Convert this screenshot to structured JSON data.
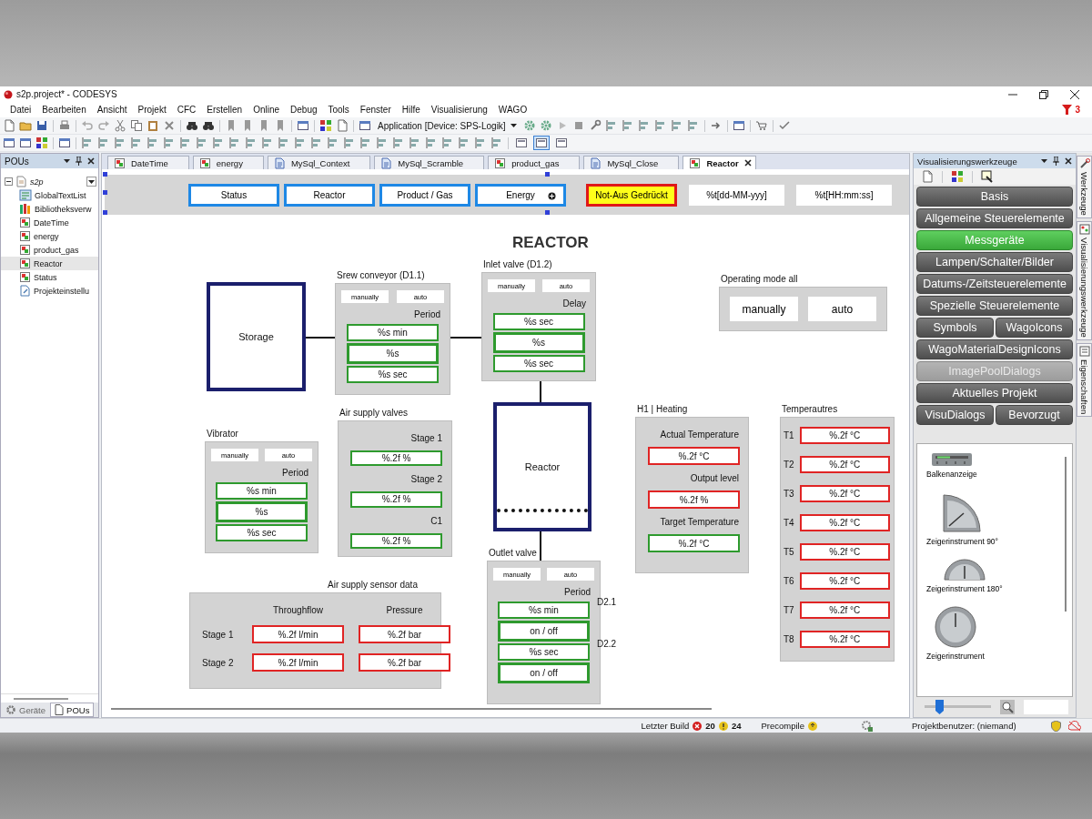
{
  "window": {
    "title": "s2p.project* - CODESYS",
    "alert_count": "3"
  },
  "menu": [
    "Datei",
    "Bearbeiten",
    "Ansicht",
    "Projekt",
    "CFC",
    "Erstellen",
    "Online",
    "Debug",
    "Tools",
    "Fenster",
    "Hilfe",
    "Visualisierung",
    "WAGO"
  ],
  "toolbar": {
    "application": "Application [Device: SPS-Logik]",
    "layout_toggles": [
      {
        "selected": false
      },
      {
        "selected": true
      },
      {
        "selected": false
      }
    ]
  },
  "pou_panel": {
    "title": "POUs",
    "tree": [
      {
        "label": "s2p",
        "kind": "project",
        "selected": false,
        "expanded": true,
        "children": [
          {
            "label": "GlobalTextList",
            "kind": "textlist",
            "selected": false
          },
          {
            "label": "Bibliotheksverw",
            "kind": "library",
            "selected": false
          },
          {
            "label": "DateTime",
            "kind": "visu",
            "selected": false
          },
          {
            "label": "energy",
            "kind": "visu",
            "selected": false
          },
          {
            "label": "product_gas",
            "kind": "visu",
            "selected": false
          },
          {
            "label": "Reactor",
            "kind": "visu",
            "selected": true
          },
          {
            "label": "Status",
            "kind": "visu",
            "selected": false
          },
          {
            "label": "Projekteinstellu",
            "kind": "settings",
            "selected": false
          }
        ]
      }
    ],
    "tabs": [
      {
        "label": "Geräte",
        "selected": false
      },
      {
        "label": "POUs",
        "selected": true
      }
    ]
  },
  "editor": {
    "tabs": [
      {
        "label": "DateTime",
        "kind": "visu",
        "selected": false
      },
      {
        "label": "energy",
        "kind": "visu",
        "selected": false
      },
      {
        "label": "MySql_Context",
        "kind": "program",
        "selected": false
      },
      {
        "label": "MySql_Scramble",
        "kind": "program",
        "selected": false
      },
      {
        "label": "product_gas",
        "kind": "visu",
        "selected": false
      },
      {
        "label": "MySql_Close",
        "kind": "program",
        "selected": false
      },
      {
        "label": "Reactor",
        "kind": "visu",
        "selected": true
      }
    ],
    "header": {
      "selected": true,
      "buttons": [
        {
          "label": "Status",
          "kind": "nav",
          "hovered": false
        },
        {
          "label": "Reactor",
          "kind": "nav",
          "hovered": false
        },
        {
          "label": "Product / Gas",
          "kind": "nav",
          "hovered": false
        },
        {
          "label": "Energy",
          "kind": "nav",
          "hovered": true
        },
        {
          "label": "Not-Aus Gedrückt",
          "kind": "alarm",
          "hovered": false
        },
        {
          "label": "%t[dd-MM-yyy]",
          "kind": "display",
          "hovered": false
        },
        {
          "label": "%t[HH:mm:ss]",
          "kind": "display",
          "hovered": false
        }
      ]
    },
    "canvas": {
      "title": "REACTOR",
      "items": [
        {
          "kind": "vessel",
          "label": "Storage"
        },
        {
          "kind": "control",
          "title": "Srew conveyor (D1.1)",
          "modes": [
            "manually",
            "auto"
          ],
          "caption": "Period",
          "fields": [
            {
              "text": "%s min",
              "color": "#2e9a2e",
              "kind": "thin"
            },
            {
              "text": "%s",
              "color": "#2e9a2e",
              "kind": "thick"
            },
            {
              "text": "%s sec",
              "color": "#2e9a2e",
              "kind": "thin"
            }
          ]
        },
        {
          "kind": "control",
          "title": "Inlet valve (D1.2)",
          "modes": [
            "manually",
            "auto"
          ],
          "caption": "Delay",
          "fields": [
            {
              "text": "%s sec",
              "color": "#2e9a2e",
              "kind": "thin"
            },
            {
              "text": "%s",
              "color": "#2e9a2e",
              "kind": "thick"
            },
            {
              "text": "%s sec",
              "color": "#2e9a2e",
              "kind": "thin"
            }
          ]
        },
        {
          "kind": "modes",
          "title": "Operating mode all",
          "modes": [
            "manually",
            "auto"
          ]
        },
        {
          "kind": "tank",
          "label": "Reactor"
        },
        {
          "kind": "readouts",
          "title": "H1 | Heating",
          "rows": [
            {
              "label": "Actual Temperature",
              "text": "%.2f °C",
              "color": "#e02424"
            },
            {
              "label": "Output level",
              "text": "%.2f %",
              "color": "#e02424"
            },
            {
              "label": "Target Temperature",
              "text": "%.2f °C",
              "color": "#2e9a2e"
            }
          ]
        },
        {
          "kind": "grid",
          "title": "Temperautres",
          "rows": [
            {
              "label": "T1",
              "text": "%.2f °C",
              "color": "#e02424"
            },
            {
              "label": "T2",
              "text": "%.2f °C",
              "color": "#e02424"
            },
            {
              "label": "T3",
              "text": "%.2f °C",
              "color": "#e02424"
            },
            {
              "label": "T4",
              "text": "%.2f °C",
              "color": "#e02424"
            },
            {
              "label": "T5",
              "text": "%.2f °C",
              "color": "#e02424"
            },
            {
              "label": "T6",
              "text": "%.2f °C",
              "color": "#e02424"
            },
            {
              "label": "T7",
              "text": "%.2f °C",
              "color": "#e02424"
            },
            {
              "label": "T8",
              "text": "%.2f °C",
              "color": "#e02424"
            }
          ]
        },
        {
          "kind": "control",
          "title": "Vibrator",
          "modes": [
            "manually",
            "auto"
          ],
          "caption": "Period",
          "fields": [
            {
              "text": "%s min",
              "color": "#2e9a2e",
              "kind": "thin"
            },
            {
              "text": "%s",
              "color": "#2e9a2e",
              "kind": "thick"
            },
            {
              "text": "%s sec",
              "color": "#2e9a2e",
              "kind": "thin"
            }
          ]
        },
        {
          "kind": "readouts",
          "title": "Air supply valves",
          "rows": [
            {
              "label": "Stage 1",
              "text": "%.2f %",
              "color": "#2e9a2e"
            },
            {
              "label": "Stage 2",
              "text": "%.2f %",
              "color": "#2e9a2e"
            },
            {
              "label": "C1",
              "text": "%.2f %",
              "color": "#2e9a2e"
            }
          ]
        },
        {
          "kind": "control",
          "title": "Outlet valve",
          "modes": [
            "manually",
            "auto"
          ],
          "caption": "Period",
          "fields": [
            {
              "text": "%s min",
              "color": "#2e9a2e",
              "kind": "thin",
              "tag": "D2.1"
            },
            {
              "text": "on / off",
              "color": "#2e9a2e",
              "kind": "thick"
            },
            {
              "text": "%s sec",
              "color": "#2e9a2e",
              "kind": "thin",
              "tag": "D2.2"
            },
            {
              "text": "on / off",
              "color": "#2e9a2e",
              "kind": "thick"
            }
          ]
        },
        {
          "kind": "table",
          "title": "Air supply sensor data",
          "columns": [
            "Throughflow",
            "Pressure"
          ],
          "rows": [
            {
              "label": "Stage 1",
              "cells": [
                {
                  "text": "%.2f l/min",
                  "color": "#e02424"
                },
                {
                  "text": "%.2f bar",
                  "color": "#e02424"
                }
              ]
            },
            {
              "label": "Stage 2",
              "cells": [
                {
                  "text": "%.2f l/min",
                  "color": "#e02424"
                },
                {
                  "text": "%.2f bar",
                  "color": "#e02424"
                }
              ]
            }
          ]
        }
      ]
    }
  },
  "toolbox": {
    "title": "Visualisierungswerkzeuge",
    "categories": [
      [
        {
          "label": "Basis",
          "selected": false,
          "disabled": false
        }
      ],
      [
        {
          "label": "Allgemeine Steuerelemente",
          "selected": false,
          "disabled": false
        }
      ],
      [
        {
          "label": "Messgeräte",
          "selected": true,
          "disabled": false
        }
      ],
      [
        {
          "label": "Lampen/Schalter/Bilder",
          "selected": false,
          "disabled": false
        }
      ],
      [
        {
          "label": "Datums-/Zeitsteuerelemente",
          "selected": false,
          "disabled": false
        }
      ],
      [
        {
          "label": "Spezielle Steuerelemente",
          "selected": false,
          "disabled": false
        }
      ],
      [
        {
          "label": "Symbols",
          "selected": false,
          "disabled": false
        },
        {
          "label": "WagoIcons",
          "selected": false,
          "disabled": false
        }
      ],
      [
        {
          "label": "WagoMaterialDesignIcons",
          "selected": false,
          "disabled": false
        }
      ],
      [
        {
          "label": "ImagePoolDialogs",
          "selected": false,
          "disabled": true
        }
      ],
      [
        {
          "label": "Aktuelles Projekt",
          "selected": false,
          "disabled": false
        }
      ],
      [
        {
          "label": "VisuDialogs",
          "selected": false,
          "disabled": false
        },
        {
          "label": "Bevorzugt",
          "selected": false,
          "disabled": false
        }
      ]
    ],
    "elements": [
      {
        "label": "Balkenanzeige",
        "kind": "bar"
      },
      {
        "label": "Zeigerinstrument 90°",
        "kind": "quarter"
      },
      {
        "label": "Zeigerinstrument 180°",
        "kind": "half"
      },
      {
        "label": "Zeigerinstrument",
        "kind": "full"
      }
    ],
    "zoom": {
      "level": 0.22
    }
  },
  "side_tabs": [
    "Werkzeuge",
    "Visualisierungswerkzeuge",
    "Eigenschaften"
  ],
  "status_bar": {
    "build_label": "Letzter Build",
    "errors": "20",
    "warnings": "24",
    "precompile": "Precompile",
    "user": "Projektbenutzer: (niemand)"
  }
}
